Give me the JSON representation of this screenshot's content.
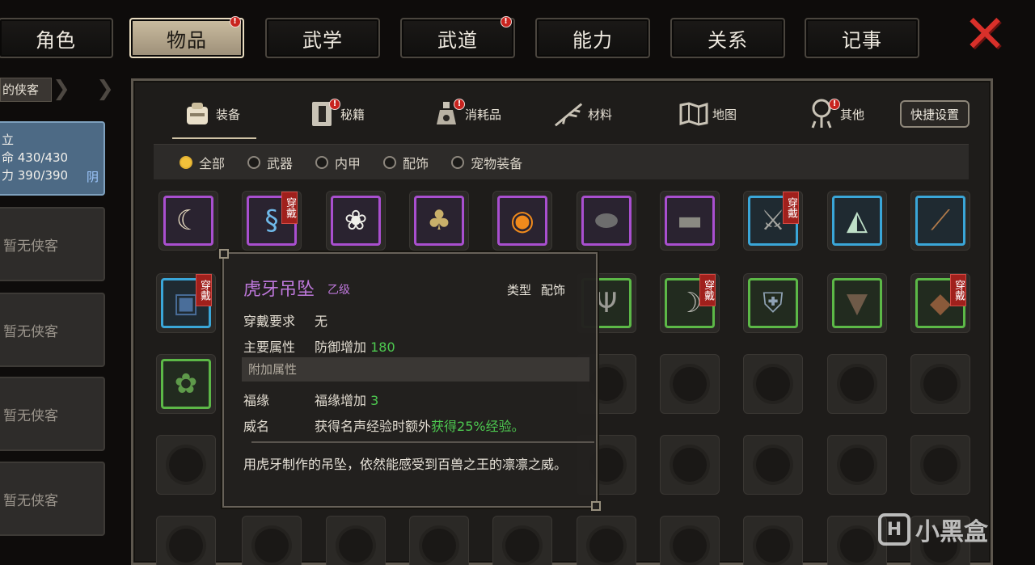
{
  "top_tabs": [
    {
      "label": "角色",
      "badge": false,
      "active": false
    },
    {
      "label": "物品",
      "badge": true,
      "active": true
    },
    {
      "label": "武学",
      "badge": false,
      "active": false
    },
    {
      "label": "武道",
      "badge": true,
      "active": false
    },
    {
      "label": "能力",
      "badge": false,
      "active": false
    },
    {
      "label": "关系",
      "badge": false,
      "active": false
    },
    {
      "label": "记事",
      "badge": false,
      "active": false
    }
  ],
  "close_icon": "close-x-icon",
  "sidebar": {
    "header": "的侠客",
    "active_card": {
      "name_fragment": "立",
      "hp": "命 430/430",
      "mp": "力 390/390",
      "attribute": "阴"
    },
    "empty_label": "暂无侠客"
  },
  "categories": [
    {
      "label": "装备",
      "icon": "armor-icon",
      "badge": false,
      "active": true
    },
    {
      "label": "秘籍",
      "icon": "book-icon",
      "badge": true,
      "active": false
    },
    {
      "label": "消耗品",
      "icon": "potion-icon",
      "badge": true,
      "active": false
    },
    {
      "label": "材料",
      "icon": "herb-icon",
      "badge": false,
      "active": false
    },
    {
      "label": "地图",
      "icon": "map-icon",
      "badge": false,
      "active": false
    },
    {
      "label": "其他",
      "icon": "misc-icon",
      "badge": true,
      "active": false
    }
  ],
  "quick_settings_label": "快捷设置",
  "filters": [
    {
      "label": "全部",
      "selected": true
    },
    {
      "label": "武器",
      "selected": false
    },
    {
      "label": "内甲",
      "selected": false
    },
    {
      "label": "配饰",
      "selected": false
    },
    {
      "label": "宠物装备",
      "selected": false
    }
  ],
  "equipped_tag": "穿戴",
  "items_row1": [
    {
      "icon": "fang-pendant-icon",
      "quality": "purple",
      "equipped": false
    },
    {
      "icon": "blue-necklace-icon",
      "quality": "purple",
      "equipped": true
    },
    {
      "icon": "jade-flower-icon",
      "quality": "purple",
      "equipped": false
    },
    {
      "icon": "gold-ore-icon",
      "quality": "purple",
      "equipped": false
    },
    {
      "icon": "orange-eye-pet-icon",
      "quality": "purple",
      "equipped": false
    },
    {
      "icon": "iron-shield-icon",
      "quality": "purple",
      "equipped": false
    },
    {
      "icon": "iron-bar-icon",
      "quality": "purple",
      "equipped": false
    },
    {
      "icon": "halberd-icon",
      "quality": "blue",
      "equipped": true
    },
    {
      "icon": "folding-fan-icon",
      "quality": "blue",
      "equipped": false
    },
    {
      "icon": "wooden-flute-icon",
      "quality": "blue",
      "equipped": false
    }
  ],
  "items_row2_visible": [
    {
      "icon": "blue-armor-icon",
      "quality": "blue",
      "equipped": true
    },
    {
      "icon": "trident-icon",
      "quality": "green",
      "equipped": false
    },
    {
      "icon": "curved-blade-icon",
      "quality": "green",
      "equipped": true
    },
    {
      "icon": "steel-armor-icon",
      "quality": "green",
      "equipped": false
    },
    {
      "icon": "brown-robe-icon",
      "quality": "green",
      "equipped": false
    },
    {
      "icon": "leather-bag-icon",
      "quality": "green",
      "equipped": true
    }
  ],
  "items_row3": [
    {
      "icon": "herb-bundle-icon",
      "quality": "green",
      "equipped": false
    }
  ],
  "tooltip": {
    "name": "虎牙吊坠",
    "grade": "乙级",
    "type_label": "类型",
    "type_value": "配饰",
    "req_label": "穿戴要求",
    "req_value": "无",
    "main_label": "主要属性",
    "main_value": "防御增加",
    "main_number": "180",
    "extra_header": "附加属性",
    "extra1_label": "福缘",
    "extra1_value": "福缘增加",
    "extra1_number": "3",
    "extra2_label": "威名",
    "extra2_value": "获得名声经验时额外",
    "extra2_highlight": "获得25%经验。",
    "description": "用虎牙制作的吊坠，依然能感受到百兽之王的凛凛之威。"
  },
  "watermark": "小黑盒",
  "colors": {
    "accent_gold": "#f2c13a",
    "rarity_purple": "#a94fcf",
    "rarity_blue": "#3aa6d8",
    "rarity_green": "#5cb847",
    "badge_red": "#c8231e"
  }
}
